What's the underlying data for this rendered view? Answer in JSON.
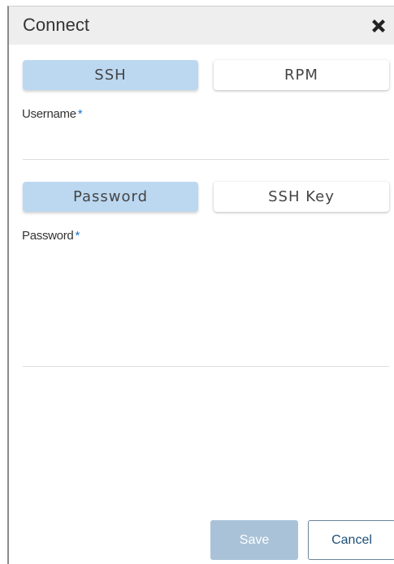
{
  "dialog": {
    "title": "Connect",
    "close_icon": "close-icon"
  },
  "protocol": {
    "options": [
      "SSH",
      "RPM"
    ],
    "selected": "SSH"
  },
  "username": {
    "label": "Username",
    "required_mark": "*",
    "value": ""
  },
  "auth": {
    "options": [
      "Password",
      "SSH Key"
    ],
    "selected": "Password"
  },
  "password": {
    "label": "Password",
    "required_mark": "*",
    "value": ""
  },
  "footer": {
    "save_label": "Save",
    "cancel_label": "Cancel"
  },
  "colors": {
    "active_segment": "#bcd8f1",
    "header_bg": "#eeeeee",
    "required": "#1a73c9",
    "save_disabled": "#a9c2d8",
    "cancel_border": "#6a8398"
  }
}
